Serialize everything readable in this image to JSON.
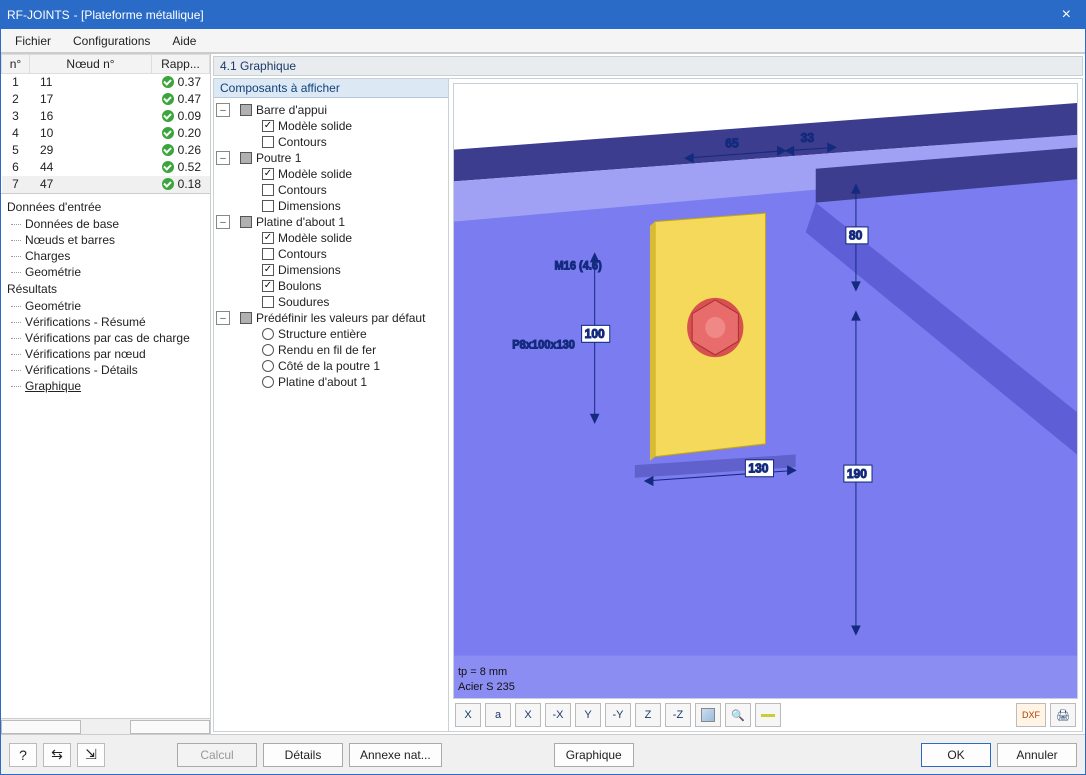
{
  "title": {
    "app": "RF-JOINTS",
    "model": " - [Plateforme métallique]"
  },
  "menu": {
    "file": "Fichier",
    "config": "Configurations",
    "help": "Aide"
  },
  "left_table": {
    "headers": {
      "num": "n°",
      "node": "Nœud n°",
      "ratio": "Rapp..."
    },
    "rows": [
      {
        "n": "1",
        "node": "11",
        "ratio": "0.37"
      },
      {
        "n": "2",
        "node": "17",
        "ratio": "0.47"
      },
      {
        "n": "3",
        "node": "16",
        "ratio": "0.09"
      },
      {
        "n": "4",
        "node": "10",
        "ratio": "0.20"
      },
      {
        "n": "5",
        "node": "29",
        "ratio": "0.26"
      },
      {
        "n": "6",
        "node": "44",
        "ratio": "0.52"
      },
      {
        "n": "7",
        "node": "47",
        "ratio": "0.18"
      }
    ]
  },
  "nav": {
    "input_hd": "Données d'entrée",
    "input": [
      "Données de base",
      "Nœuds et barres",
      "Charges",
      "Geométrie"
    ],
    "result_hd": "Résultats",
    "result": [
      "Geométrie",
      "Vérifications - Résumé",
      "Vérifications par cas de charge",
      "Vérifications par nœud",
      "Vérifications - Détails",
      "Graphique"
    ]
  },
  "viewport_header": "4.1 Graphique",
  "tree": {
    "header": "Composants à afficher",
    "n1": "Barre d'appui",
    "n1a": "Modèle solide",
    "n1b": "Contours",
    "n2": "Poutre 1",
    "n2a": "Modèle solide",
    "n2b": "Contours",
    "n2c": "Dimensions",
    "n3": "Platine d'about 1",
    "n3a": "Modèle solide",
    "n3b": "Contours",
    "n3c": "Dimensions",
    "n3d": "Boulons",
    "n3e": "Soudures",
    "n4": "Prédéfinir les valeurs par défaut",
    "n4a": "Structure entière",
    "n4b": "Rendu en fil de fer",
    "n4c": "Côté de la poutre  1",
    "n4d": "Platine d'about 1"
  },
  "dims": {
    "d65": "65",
    "d33": "33",
    "d80": "80",
    "d100": "100",
    "d130": "130",
    "d190": "190",
    "bolt": "M16 (4.6)",
    "plate": "P8x100x130",
    "tp": "tp = 8 mm",
    "steel": "Acier S 235"
  },
  "toolbar3d": {
    "t1": "X",
    "t2": "a",
    "t3": "X",
    "t4": "-X",
    "t5": "Y",
    "t6": "-Y",
    "t7": "Z",
    "t8": "-Z",
    "dxf": "DXF"
  },
  "footer": {
    "calc": "Calcul",
    "details": "Détails",
    "annex": "Annexe nat...",
    "view_toggle": "Graphique",
    "ok": "OK",
    "cancel": "Annuler"
  }
}
